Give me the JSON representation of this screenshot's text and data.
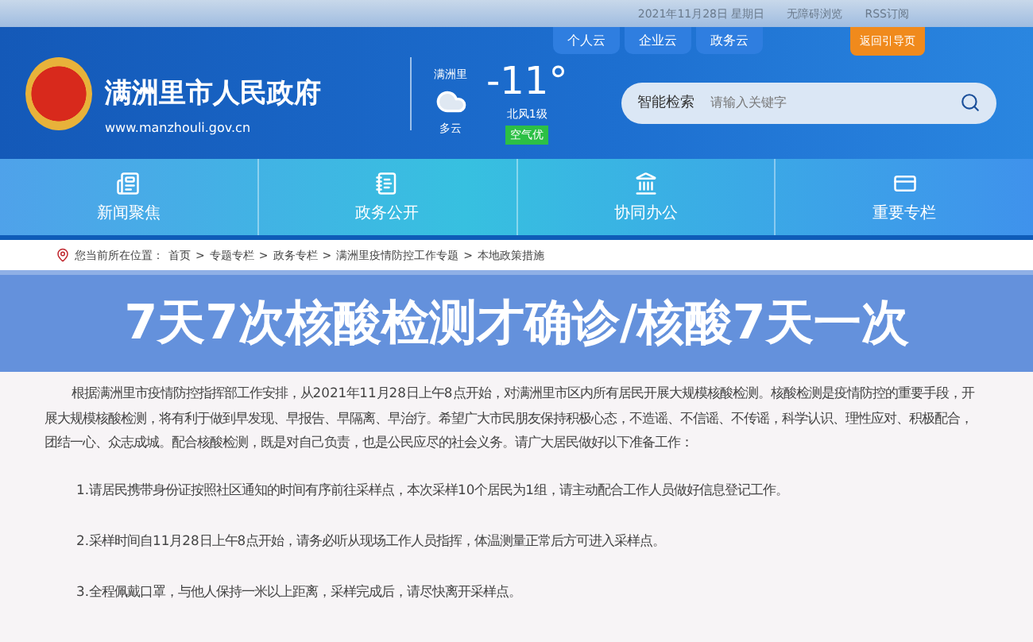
{
  "top_bar": {
    "date": "2021年11月28日 星期日",
    "links": [
      "无障碍浏览",
      "RSS订阅"
    ]
  },
  "header": {
    "site_name": "满洲里市人民政府",
    "url": "www.manzhouli.gov.cn",
    "cloud_tabs": [
      "个人云",
      "企业云",
      "政务云"
    ],
    "guide_button": "返回引导页",
    "weather": {
      "city": "满洲里",
      "condition": "多云",
      "temperature": "-11°",
      "wind": "北风1级",
      "air": "空气优"
    },
    "search": {
      "label": "智能检索",
      "placeholder": "请输入关键字"
    }
  },
  "nav": [
    {
      "label": "新闻聚焦",
      "kind": "news"
    },
    {
      "label": "政务公开",
      "kind": "notebook"
    },
    {
      "label": "协同办公",
      "kind": "building"
    },
    {
      "label": "重要专栏",
      "kind": "card"
    }
  ],
  "breadcrumb": {
    "prefix": "您当前所在位置：",
    "separator": ">",
    "items": [
      "首页",
      "专题专栏",
      "政务专栏",
      "满洲里疫情防控工作专题",
      "本地政策措施"
    ]
  },
  "banner": {
    "text": "7天7次核酸检测才确诊/核酸7天一次"
  },
  "article": {
    "intro": "根据满洲里市疫情防控指挥部工作安排，从2021年11月28日上午8点开始，对满洲里市区内所有居民开展大规模核酸检测。核酸检测是疫情防控的重要手段，开展大规模核酸检测，将有利于做到早发现、早报告、早隔离、早治疗。希望广大市民朋友保持积极心态，不造谣、不信谣、不传谣，科学认识、理性应对、积极配合，团结一心、众志成城。配合核酸检测，既是对自己负责，也是公民应尽的社会义务。请广大居民做好以下准备工作：",
    "items": [
      "1.请居民携带身份证按照社区通知的时间有序前往采样点，本次采样10个居民为1组，请主动配合工作人员做好信息登记工作。",
      "2.采样时间自11月28日上午8点开始，请务必听从现场工作人员指挥，体温测量正常后方可进入采样点。",
      "3.全程佩戴口罩，与他人保持一米以上距离，采样完成后，请尽快离开采样点。"
    ]
  }
}
